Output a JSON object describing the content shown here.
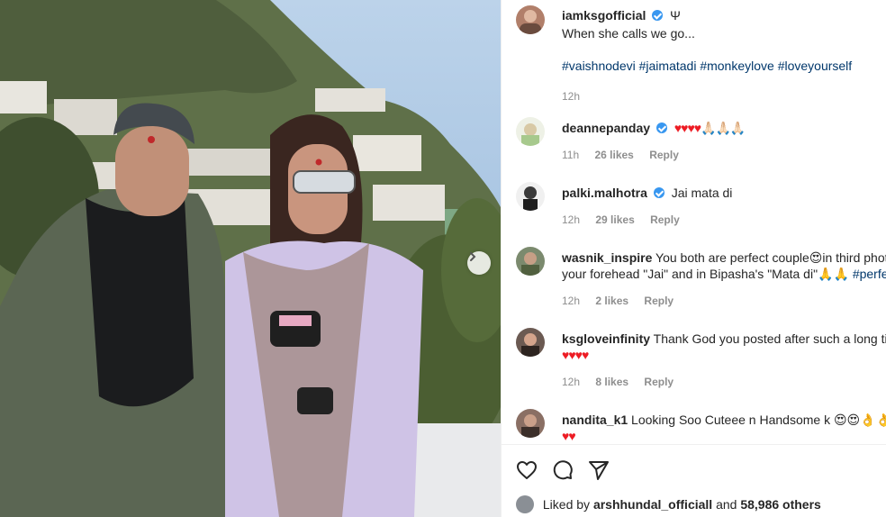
{
  "post": {
    "author": "iamksgofficial",
    "badge_symbol": "Ψ",
    "caption": "When she calls we go...",
    "hashtags": "#vaishnodevi #jaimatadi #monkeylove #loveyourself",
    "time": "12h"
  },
  "comments": [
    {
      "username": "deannepanday",
      "verified": true,
      "text": "♥♥♥♥🙏🏻🙏🏻🙏🏻",
      "time": "11h",
      "likes": "26 likes",
      "reply": "Reply"
    },
    {
      "username": "palki.malhotra",
      "verified": true,
      "text": "Jai mata di",
      "time": "12h",
      "likes": "29 likes",
      "reply": "Reply"
    },
    {
      "username": "wasnik_inspire",
      "verified": false,
      "text_line1": "You both are perfect couple😍in third photo",
      "text_line2_a": "your forehead \"Jai\" and in Bipasha's \"Mata di\"🙏🙏 ",
      "text_line2_b": "#perfect",
      "time": "12h",
      "likes": "2 likes",
      "reply": "Reply"
    },
    {
      "username": "ksgloveinfinity",
      "verified": false,
      "text_line1": "Thank God you posted after such a long time",
      "text_line2": "♥♥♥♥",
      "time": "12h",
      "likes": "8 likes",
      "reply": "Reply"
    },
    {
      "username": "nandita_k1",
      "verified": false,
      "text_line1": "Looking Soo Cuteee n Handsome k 😍😍👌👌👌",
      "text_line2": "♥♥"
    }
  ],
  "actions": {
    "liked_by_prefix": "Liked by",
    "liked_by_user": "arshhundal_officiall",
    "liked_by_joiner": "and",
    "liked_by_count": "58,986 others"
  },
  "colors": {
    "link": "#00376b",
    "verified": "#3897f0",
    "heart": "#ed1c24",
    "muted": "#8e8e8e"
  }
}
